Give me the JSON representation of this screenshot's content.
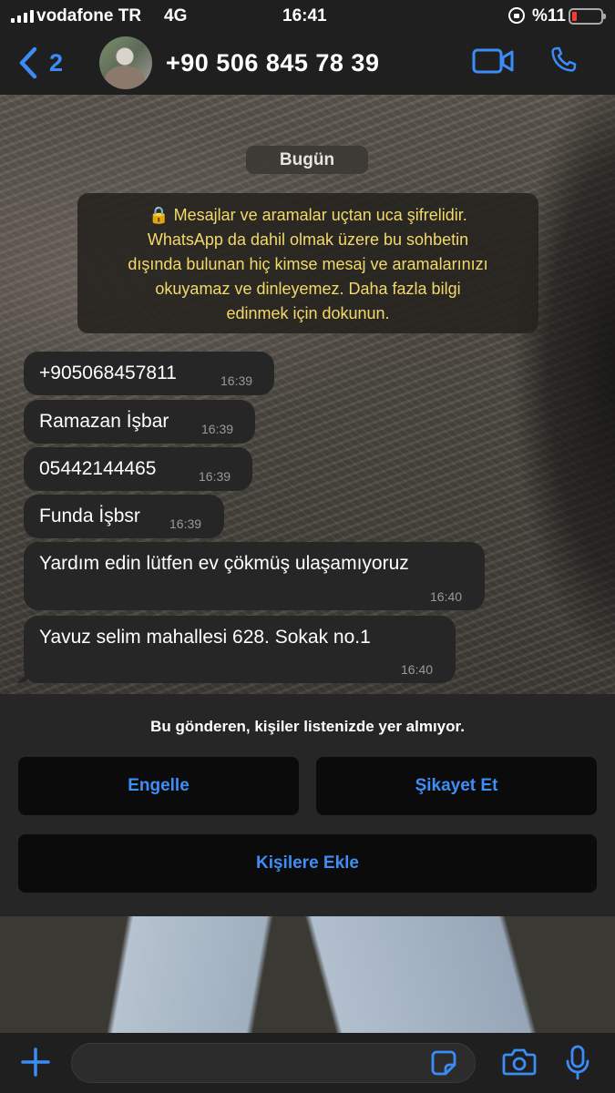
{
  "status_bar": {
    "carrier": "vodafone TR",
    "network": "4G",
    "time": "16:41",
    "battery": "%11"
  },
  "header": {
    "back_count": "2",
    "contact": "+90 506 845 78 39"
  },
  "chat": {
    "date": "Bugün",
    "encryption_lines": [
      "🔒 Mesajlar ve aramalar uçtan uca şifrelidir.",
      "WhatsApp da dahil olmak üzere bu sohbetin",
      "dışında bulunan hiç kimse mesaj ve aramalarınızı",
      "okuyamaz ve dinleyemez. Daha fazla bilgi",
      "edinmek için dokunun."
    ],
    "messages": [
      {
        "text": "+905068457811",
        "time": "16:39"
      },
      {
        "text": "Ramazan İşbar",
        "time": "16:39"
      },
      {
        "text": "05442144465",
        "time": "16:39"
      },
      {
        "text": "Funda İşbsr",
        "time": "16:39"
      },
      {
        "text": "Yardım edin lütfen ev çökmüş ulaşamıyoruz",
        "time": "16:40"
      },
      {
        "text": "Yavuz selim mahallesi 628. Sokak no.1",
        "time": "16:40"
      }
    ]
  },
  "unknown_sender": {
    "notice": "Bu gönderen, kişiler listenizde yer almıyor.",
    "block_label": "Engelle",
    "report_label": "Şikayet Et",
    "add_label": "Kişilere Ekle"
  },
  "colors": {
    "accent": "#3b8cf7",
    "notice_text": "#f3d96a",
    "bubble": "#262626",
    "battery_low": "#ff3b30"
  },
  "icons": {
    "back": "chevron-left-icon",
    "video": "video-camera-icon",
    "call": "phone-icon",
    "attach": "plus-icon",
    "sticker": "sticker-icon",
    "camera": "camera-icon",
    "mic": "microphone-icon"
  }
}
